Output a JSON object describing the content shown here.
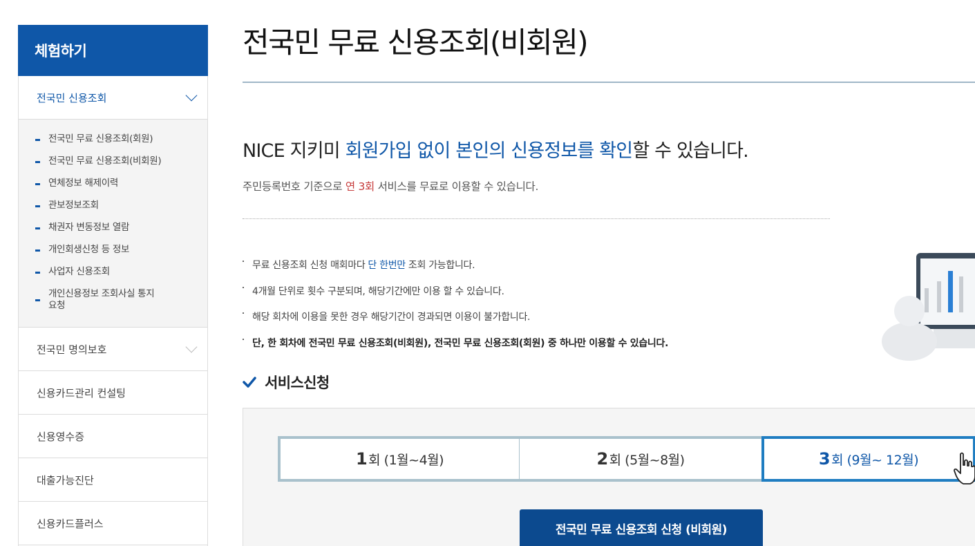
{
  "sidebar": {
    "header": "체험하기",
    "items": [
      {
        "label": "전국민 신용조회"
      },
      {
        "label": "전국민 명의보호"
      },
      {
        "label": "신용카드관리 컨설팅"
      },
      {
        "label": "신용영수증"
      },
      {
        "label": "대출가능진단"
      },
      {
        "label": "신용카드플러스"
      }
    ],
    "submenu": [
      {
        "label": "전국민 무료 신용조회(회원)"
      },
      {
        "label": "전국민 무료 신용조회(비회원)"
      },
      {
        "label": "연체정보 해제이력"
      },
      {
        "label": "관보정보조회"
      },
      {
        "label": "채권자 변동정보 열람"
      },
      {
        "label": "개인회생신청 등 정보"
      },
      {
        "label": "사업자 신용조회"
      },
      {
        "label": "개인신용정보 조회사실 통지요청"
      }
    ]
  },
  "main": {
    "title": "전국민 무료 신용조회(비회원)",
    "headline": {
      "part1": "NICE 지키미 ",
      "highlight": "회원가입 없이 본인의 신용정보를 확인",
      "part2": "할 수 있습니다."
    },
    "subtext": {
      "part1": "주민등록번호 기준으로 ",
      "highlight": "연 3회",
      "part2": " 서비스를 무료로 이용할 수 있습니다."
    },
    "notes": [
      {
        "part1": "무료 신용조회 신청 매회마다",
        "highlight": "단 한번만",
        "part2": "조회 가능합니다."
      },
      {
        "text": "4개월 단위로 횟수 구분되며, 해당기간에만 이용 할 수 있습니다."
      },
      {
        "text": "해당 회차에 이용을 못한 경우 해당기간이 경과되면 이용이 불가합니다."
      },
      {
        "text": "단, 한 회차에 전국민 무료 신용조회(비회원), 전국민 무료 신용조회(회원) 중 하나만 이용할 수 있습니다."
      }
    ],
    "section_title": "서비스신청",
    "rounds": [
      {
        "num": "1",
        "unit": "회",
        "period": "(1월~4월)"
      },
      {
        "num": "2",
        "unit": "회",
        "period": "(5월~8월)"
      },
      {
        "num": "3",
        "unit": "회",
        "period": "(9월~ 12월)"
      }
    ],
    "apply_button": "전국민 무료 신용조회 신청 (비회원)"
  },
  "colors": {
    "brand_blue": "#0f57a8",
    "accent_red": "#c63a3a",
    "selected_border": "#1f7dc1"
  }
}
